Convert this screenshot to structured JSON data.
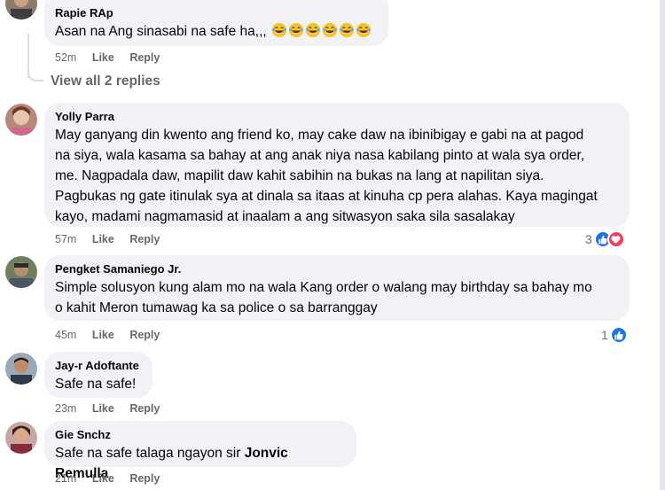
{
  "comments": [
    {
      "author": "Rapie RAp",
      "text": "Asan na Ang sinasabi na safe ha,,,",
      "emoji_count": 6,
      "emoji": "laughing-tears-emoji",
      "time": "52m",
      "like": "Like",
      "reply": "Reply"
    },
    {
      "author": "Yolly Parra",
      "lines": [
        "May ganyang din kwento ang friend ko, may cake daw na ibinibigay e gabi na at pagod",
        "na siya, wala kasama sa bahay at ang anak niya nasa kabilang pinto at wala sya order,",
        "me. Nagpadala daw, mapilit daw kahit sabihin na bukas na lang at napilitan siya.",
        "Pagbukas ng gate itinulak sya at dinala sa itaas at kinuha cp pera alahas. Kaya magingat",
        "kayo, madami nagmamasid at inaalam a ang sitwasyon saka sila sasalakay"
      ],
      "time": "57m",
      "like": "Like",
      "reply": "Reply",
      "reaction_count": "3",
      "reactions": [
        "like-icon",
        "heart-icon"
      ]
    },
    {
      "author": "Pengket Samaniego Jr.",
      "lines": [
        "Simple solusyon kung alam mo na wala Kang order o walang may birthday sa bahay mo",
        "o kahit Meron tumawag ka sa police o sa barranggay"
      ],
      "time": "45m",
      "like": "Like",
      "reply": "Reply",
      "reaction_count": "1",
      "reactions": [
        "like-icon"
      ]
    },
    {
      "author": "Jay-r Adoftante",
      "text": "Safe na safe!",
      "time": "23m",
      "like": "Like",
      "reply": "Reply"
    },
    {
      "author": "Gie Snchz",
      "text_prefix": "Safe na safe talaga ngayon sir ",
      "mention": "Jonvic Remulla",
      "time": "21m",
      "like": "Like",
      "reply": "Reply"
    }
  ],
  "view_replies": "View all 2 replies",
  "colors": {
    "bubble": "#f0f2f5",
    "meta": "#65676b",
    "like_blue": "#1b74e4",
    "heart_red": "#f33e58"
  }
}
